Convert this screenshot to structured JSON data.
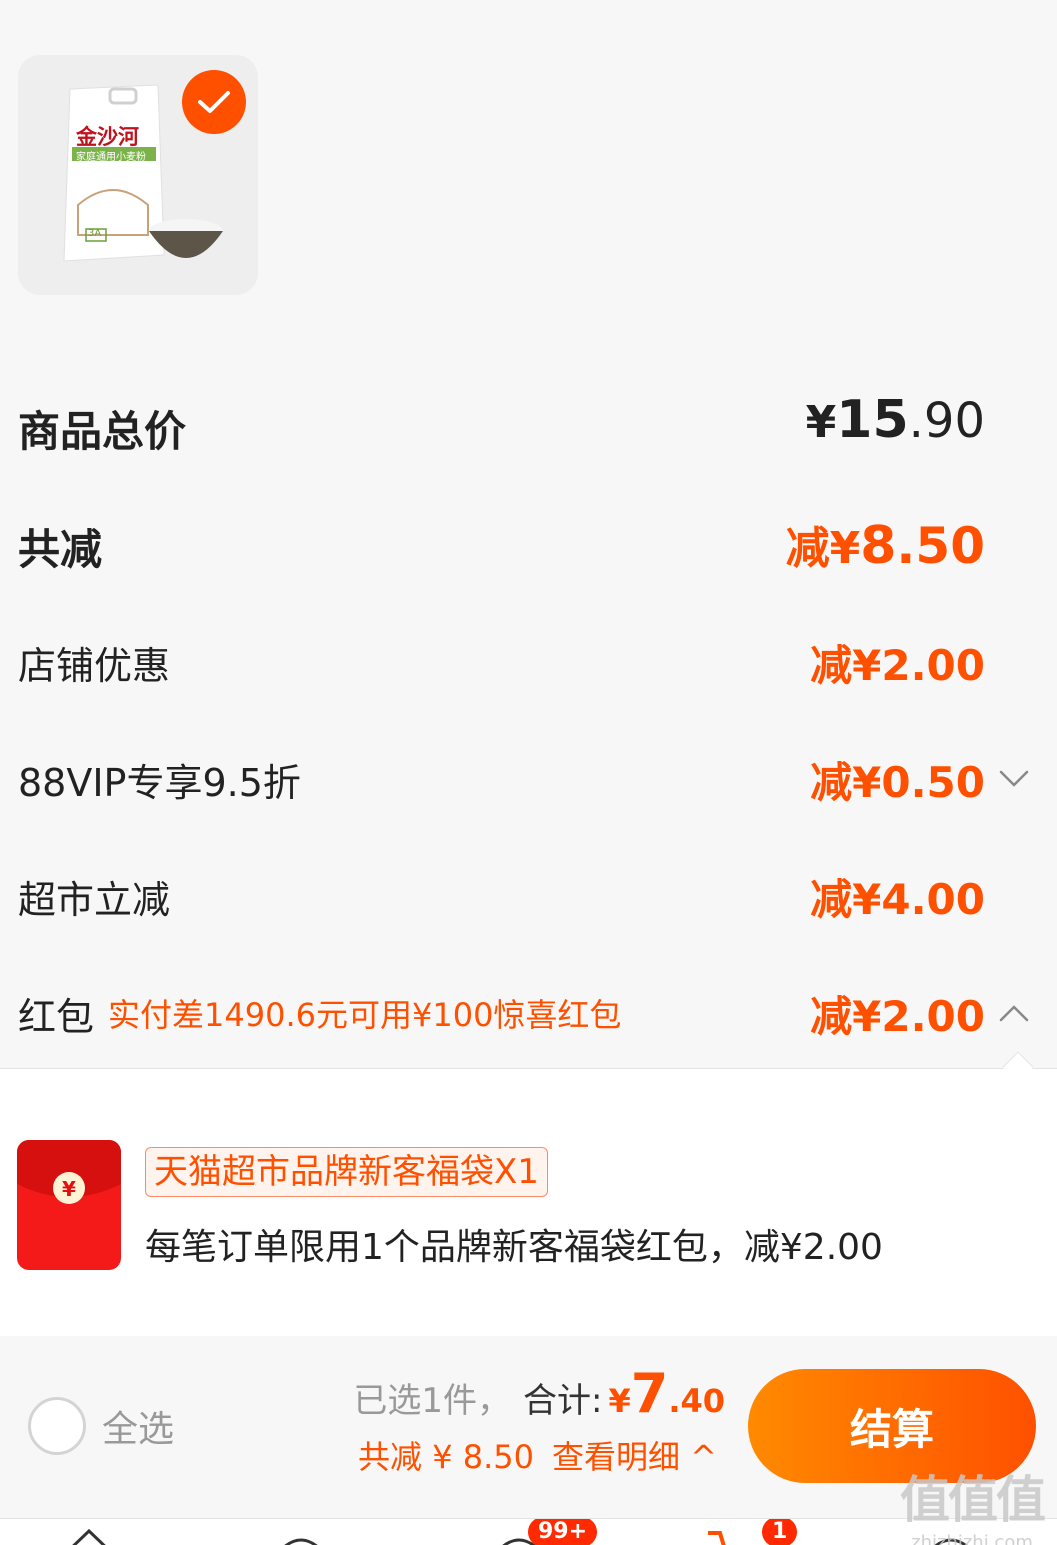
{
  "product": {
    "image_icon": "flour-bag-image",
    "brand_text": "金沙河",
    "sub_text": "家庭通用小麦粉",
    "grade_text": "3A",
    "selected": true
  },
  "price_rows": {
    "total": {
      "label": "商品总价",
      "yen": "¥",
      "int": "15",
      "cents": ".90"
    },
    "total_discount": {
      "label": "共减",
      "prefix": "减",
      "yen": "¥",
      "int": "8",
      "cents": ".50"
    },
    "shop_discount": {
      "label": "店铺优惠",
      "value": "减¥2.00"
    },
    "vip_discount": {
      "label": "88VIP专享9.5折",
      "value": "减¥0.50",
      "icon": "chevron-down-icon"
    },
    "market_discount": {
      "label": "超市立减",
      "value": "减¥4.00"
    },
    "red_packet": {
      "label": "红包",
      "note": "实付差1490.6元可用¥100惊喜红包",
      "value": "减¥2.00",
      "icon": "chevron-up-icon"
    }
  },
  "coupon": {
    "icon": "red-envelope-icon",
    "tag": "天猫超市品牌新客福袋X1",
    "description": "每笔订单限用1个品牌新客福袋红包，减¥2.00"
  },
  "bottom_bar": {
    "select_all": "全选",
    "selected_count": "已选1件，",
    "total_label": "合计:",
    "pay_yen": "¥",
    "pay_int": "7",
    "pay_cents": ".40",
    "discount_summary": "共减 ¥ 8.50",
    "detail_link": "查看明细 ^",
    "checkout": "结算"
  },
  "tab_bar": {
    "badges": [
      "99+",
      "1"
    ]
  },
  "watermark": {
    "big": "值值值",
    "small": "zhizhizhi.com"
  },
  "colors": {
    "accent": "#ff5000",
    "background": "#f7f7f7"
  }
}
